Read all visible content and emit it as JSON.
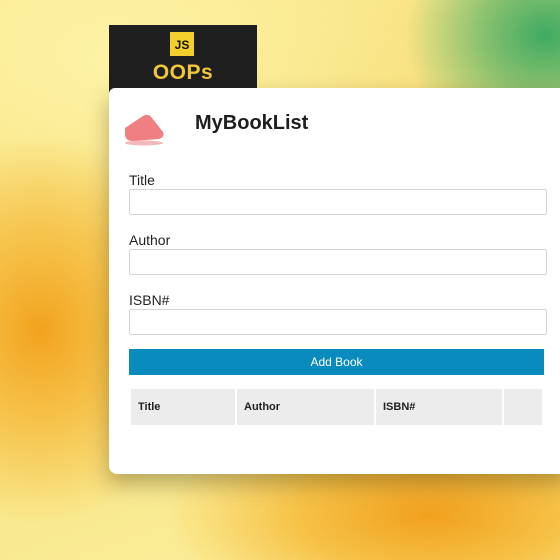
{
  "badge": {
    "icon_text": "JS",
    "title": "OOPs"
  },
  "app": {
    "title": "MyBookList",
    "logo_color": "#ef7f82"
  },
  "form": {
    "title_label": "Title",
    "title_value": "",
    "author_label": "Author",
    "author_value": "",
    "isbn_label": "ISBN#",
    "isbn_value": "",
    "submit_label": "Add Book",
    "accent": "#0a8bbd"
  },
  "table": {
    "headers": [
      "Title",
      "Author",
      "ISBN#",
      ""
    ],
    "rows": []
  }
}
